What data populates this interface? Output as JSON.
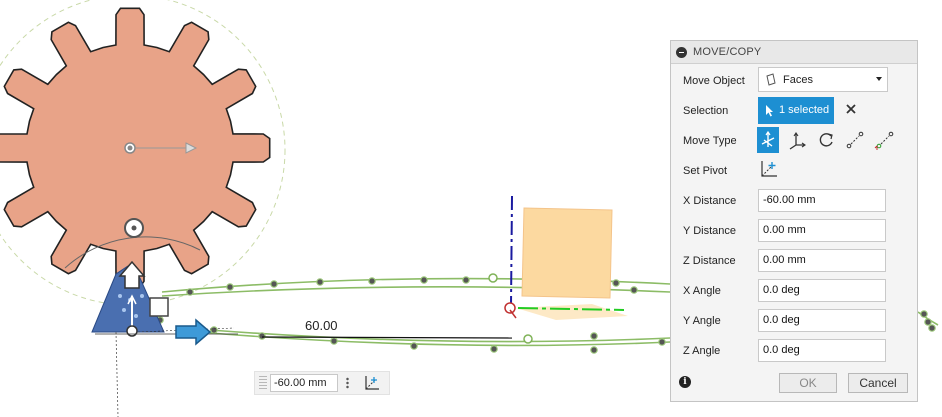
{
  "viewport": {
    "dimension_label": "60.00",
    "mini_toolbar": {
      "distance_value": "-60.00 mm",
      "more_icon": "vertical-ellipsis-icon",
      "pivot_icon": "set-pivot-icon"
    }
  },
  "panel": {
    "title": "MOVE/COPY",
    "move_object": {
      "label": "Move Object",
      "value": "Faces",
      "icon": "face-icon"
    },
    "selection": {
      "label": "Selection",
      "button_label": "1 selected",
      "clear_icon": "close-icon"
    },
    "move_type": {
      "label": "Move Type",
      "options": [
        "free-move",
        "translate-xyz",
        "rotate",
        "point-to-point",
        "point-to-position"
      ],
      "active_index": 0
    },
    "set_pivot": {
      "label": "Set Pivot",
      "icon": "set-pivot-icon"
    },
    "fields": [
      {
        "label": "X Distance",
        "value": "-60.00 mm"
      },
      {
        "label": "Y Distance",
        "value": "0.00 mm"
      },
      {
        "label": "Z Distance",
        "value": "0.00 mm"
      },
      {
        "label": "X Angle",
        "value": "0.0 deg"
      },
      {
        "label": "Y Angle",
        "value": "0.0 deg"
      },
      {
        "label": "Z Angle",
        "value": "0.0 deg"
      }
    ],
    "footer": {
      "ok_label": "OK",
      "cancel_label": "Cancel",
      "info_icon": "info-icon"
    }
  },
  "colors": {
    "gear_fill": "#e8a388",
    "accent_blue": "#1d8fd2",
    "path_green": "#7fb257",
    "pivot_green": "#22cc22",
    "axis_navy": "#1a1aa0",
    "plane_orange": "#fcd9a0"
  }
}
